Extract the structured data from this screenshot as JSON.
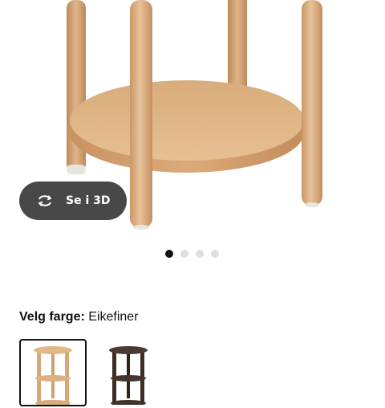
{
  "product": {
    "view_3d_label": "Se i 3D",
    "gallery_dot_count": 4,
    "gallery_active_index": 0
  },
  "color_selector": {
    "label": "Velg farge:",
    "selected_value": "Eikefiner",
    "options": [
      "oak-veneer",
      "dark-brown"
    ]
  },
  "icons": {
    "view_3d": "rotate-arrows-icon"
  },
  "colors": {
    "button_bg": "#484848",
    "dot_active": "#111111",
    "dot_inactive": "#dfdfdf",
    "wood_light": "#d9ae7f",
    "wood_dark": "#3a2e27"
  }
}
